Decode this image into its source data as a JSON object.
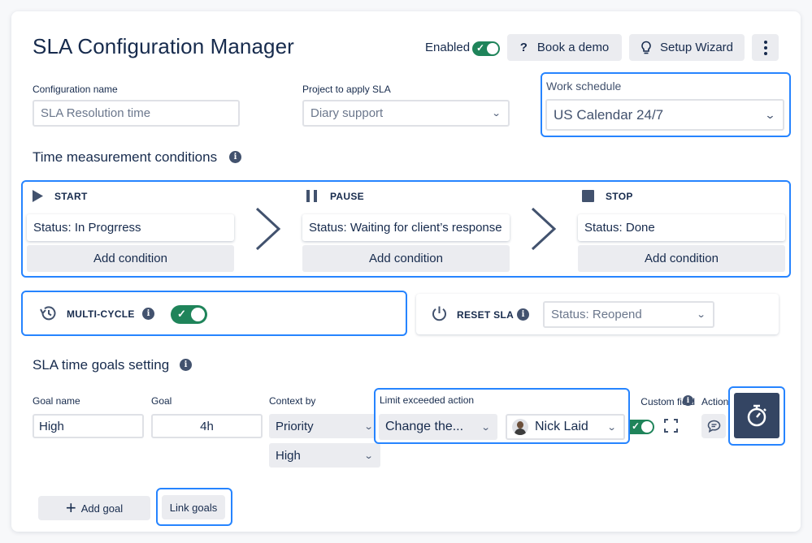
{
  "app": {
    "title": "SLA Configuration Manager"
  },
  "header": {
    "enabled_label": "Enabled",
    "book_demo_label": "Book a demo",
    "setup_wizard_label": "Setup Wizard"
  },
  "config": {
    "name_label": "Configuration name",
    "name_value": "SLA Resolution time",
    "project_label": "Project to apply SLA",
    "project_value": "Diary support",
    "schedule_label": "Work schedule",
    "schedule_value": "US Calendar 24/7"
  },
  "time_conditions": {
    "title": "Time measurement conditions",
    "start": {
      "label": "START",
      "status": "Status: In Progrress",
      "add": "Add condition"
    },
    "pause": {
      "label": "PAUSE",
      "status": "Status: Waiting for client’s response",
      "add": "Add condition"
    },
    "stop": {
      "label": "STOP",
      "status": "Status: Done",
      "add": "Add condition"
    }
  },
  "multi_cycle": {
    "label": "MULTI-CYCLE"
  },
  "reset_sla": {
    "label": "RESET SLA",
    "value": "Status: Reopend"
  },
  "goals": {
    "title": "SLA time goals setting",
    "goal_name_label": "Goal name",
    "goal_name_value": "High",
    "goal_label": "Goal",
    "goal_value": "4h",
    "context_label": "Context by",
    "context_value": "Priority",
    "context_sub_value": "High",
    "limit_label": "Limit exceeded action",
    "limit_action_value": "Change the...",
    "limit_user_value": "Nick Laid",
    "custom_field_label": "Custom field",
    "actions_label": "Actions",
    "add_goal_label": "Add goal",
    "link_goals_label": "Link goals"
  },
  "colors": {
    "accent": "#2684ff",
    "toggle_on": "#1f845a",
    "dark_button": "#344563"
  }
}
